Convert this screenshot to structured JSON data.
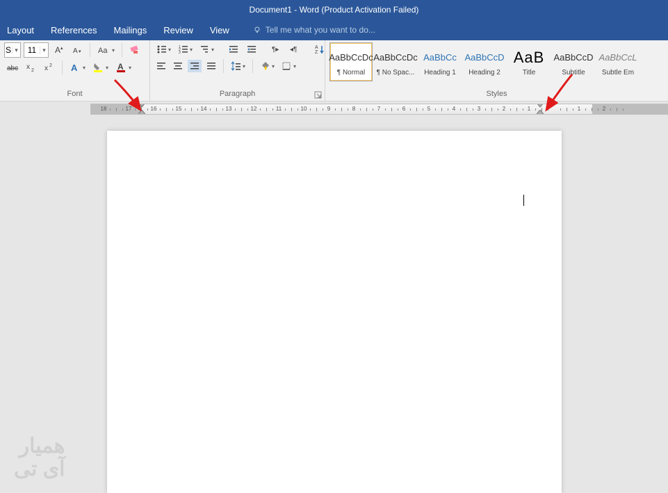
{
  "title": "Document1 - Word (Product Activation Failed)",
  "tabs": {
    "layout": "Layout",
    "references": "References",
    "mailings": "Mailings",
    "review": "Review",
    "view": "View"
  },
  "tell_me": "Tell me what you want to do...",
  "font": {
    "group_label": "Font",
    "family_suffix": "S",
    "size": "11"
  },
  "paragraph": {
    "group_label": "Paragraph"
  },
  "styles": {
    "group_label": "Styles",
    "items": [
      {
        "preview": "AaBbCcDc",
        "name": "¶ Normal",
        "cls": "",
        "selected": true
      },
      {
        "preview": "AaBbCcDc",
        "name": "¶ No Spac...",
        "cls": "",
        "selected": false
      },
      {
        "preview": "AaBbCc",
        "name": "Heading 1",
        "cls": "blue",
        "selected": false
      },
      {
        "preview": "AaBbCcD",
        "name": "Heading 2",
        "cls": "blue",
        "selected": false
      },
      {
        "preview": "AaB",
        "name": "Title",
        "cls": "title",
        "selected": false
      },
      {
        "preview": "AaBbCcD",
        "name": "Subtitle",
        "cls": "",
        "selected": false
      },
      {
        "preview": "AaBbCcL",
        "name": "Subtle Em",
        "cls": "subtle",
        "selected": false
      }
    ]
  },
  "ruler": {
    "numbers": [
      "18",
      "17",
      "16",
      "15",
      "14",
      "13",
      "12",
      "11",
      "10",
      "9",
      "8",
      "7",
      "6",
      "5",
      "4",
      "3",
      "2",
      "1",
      "",
      "1",
      "2"
    ]
  },
  "watermark": {
    "line1": "همیار",
    "line2": "آی تی"
  }
}
